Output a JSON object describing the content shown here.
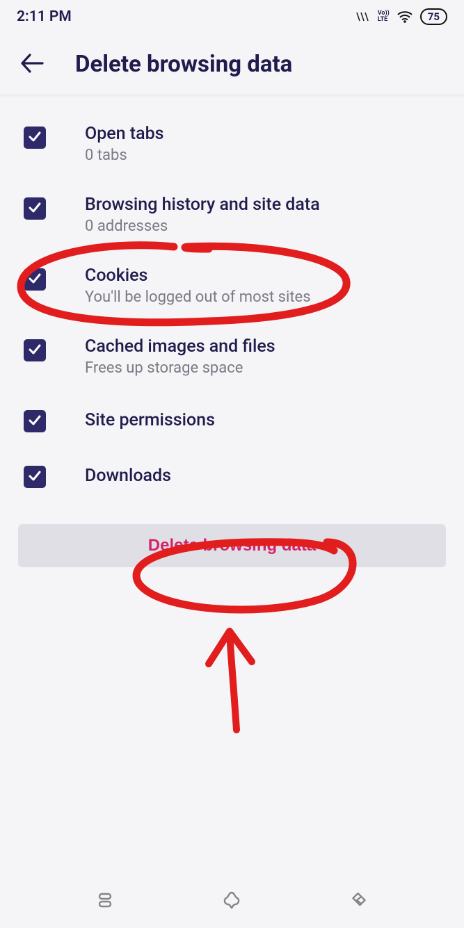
{
  "status": {
    "time": "2:11 PM",
    "volte": "Vo)) LTE",
    "battery": "75"
  },
  "header": {
    "title": "Delete browsing data"
  },
  "options": [
    {
      "title": "Open tabs",
      "subtitle": "0 tabs",
      "checked": true
    },
    {
      "title": "Browsing history and site data",
      "subtitle": "0 addresses",
      "checked": true
    },
    {
      "title": "Cookies",
      "subtitle": "You'll be logged out of most sites",
      "checked": true
    },
    {
      "title": "Cached images and files",
      "subtitle": "Frees up storage space",
      "checked": true
    },
    {
      "title": "Site permissions",
      "subtitle": "",
      "checked": true
    },
    {
      "title": "Downloads",
      "subtitle": "",
      "checked": true
    }
  ],
  "actions": {
    "delete_label": "Delete browsing data"
  },
  "annotations": {
    "circle_cookies": true,
    "circle_button": true,
    "arrow_up": true
  },
  "colors": {
    "checkbox_bg": "#2e2a6a",
    "title_color": "#201c4d",
    "subtitle_color": "#7a7a85",
    "button_bg": "#e0dfe6",
    "button_text": "#d4256b",
    "annotation_stroke": "#e11d1d"
  }
}
